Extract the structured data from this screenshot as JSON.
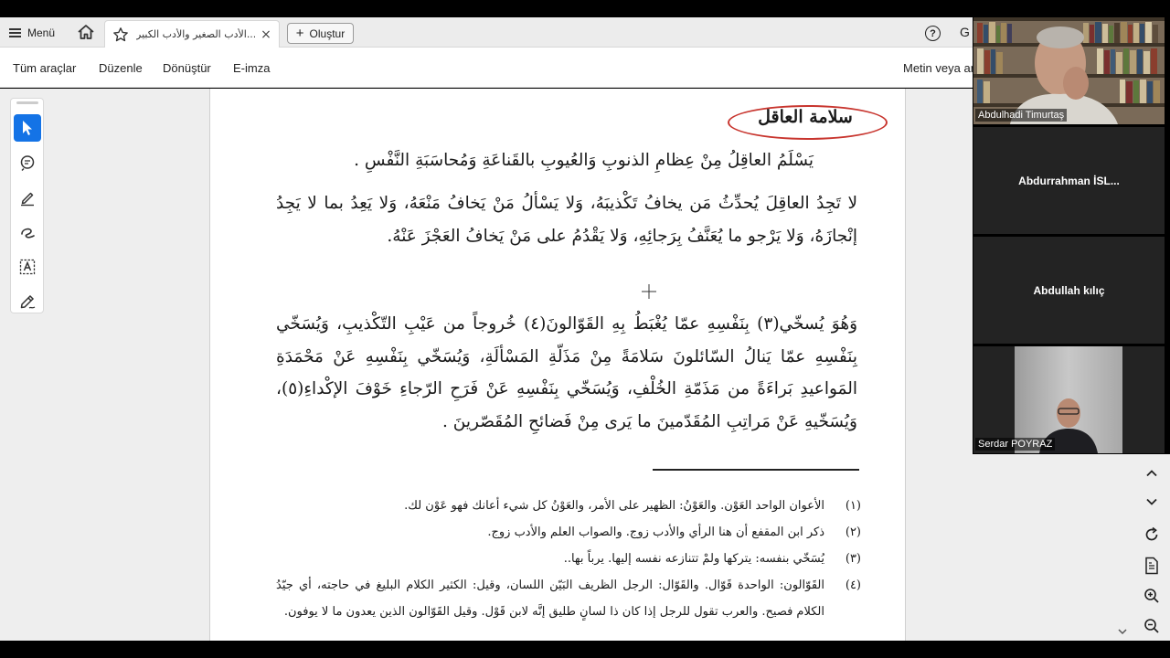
{
  "browser": {
    "menu_label": "Menü",
    "tab_title": "الأدب الصغير والأدب الكبير...",
    "close_symbol": "×",
    "create_label": "Oluştur",
    "help_symbol": "?",
    "profile_letter": "G"
  },
  "toolbar": {
    "all_tools": "Tüm araçlar",
    "edit": "Düzenle",
    "convert": "Dönüştür",
    "esign": "E-imza",
    "search_text": "Metin veya ar"
  },
  "document": {
    "heading": "سلامة العاقل",
    "paragraph1": "يَسْلَمُ العاقِلُ مِنْ عِظامِ الذنوبِ وَالعُيوبِ بالقَناعَةِ وَمُحاسَبَةِ النَّفْسِ .",
    "paragraph2": "لا تَجِدُ العاقِلَ يُحدِّثُ مَن يخافُ تَكْذيبَهُ، وَلا يَسْألُ مَنْ يَخافُ مَنْعَهُ، وَلا يَعِدُ بما لا يَجِدُ إنْجازَهُ، وَلا يَرْجو ما يُعَنَّفُ بِرَجائِهِ، وَلا يَقْدُمُ على مَنْ يَخافُ العَجْزَ عَنْهُ.",
    "paragraph3": "وَهُوَ يُسخّي(٣) بِنَفْسِهِ عمّا يُغْبَطُ بِهِ القَوّالونَ(٤) خُروجاً من عَيْبِ التّكْذيبِ، وَيُسَخّي بِنَفْسِهِ عمّا يَنالُ السّائلونَ سَلامَةً مِنْ مَذَلّةِ المَسْألَةِ، وَيُسَخّي بِنَفْسِهِ عَنْ مَحْمَدَةِ المَواعيدِ بَراءَةً من مَذَمّةِ الخُلْفِ، وَيُسَخّي بِنَفْسِهِ عَنْ فَرَحِ الرّجاءِ خَوْفَ الإكْداءِ(٥)، وَيُسَخّيهِ عَنْ مَراتِبِ المُقَدّمينَ ما يَرى مِنْ فَضائحِ المُقَصّرينَ .",
    "footnotes": [
      {
        "num": "(١)",
        "text": "الأعوان الواحد العَوْن. والعَوْنُ: الظهير على الأمر، والعَوْنُ كل شيء أعانك فهو عَوْن لك."
      },
      {
        "num": "(٢)",
        "text": "ذكر ابن المقفع أن هنا الرأي والأدب زوج. والصواب العلم والأدب زوج."
      },
      {
        "num": "(٣)",
        "text": "يُسَخّي بنفسه: يتركها ولمْ تتنازعه نفسه إليها. يرباً بها.."
      },
      {
        "num": "(٤)",
        "text": "القَوّالون: الواحدة قَوّال. والقَوّال: الرجل الظريف البَيّن اللسان، وقيل: الكثير الكلام البليغ في حاجته، أي جيّدُ الكلام فصيح. والعرب تقول للرجل إذا كان ذا لسانٍ طليق إنَّه لابن قَوْل. وقيل القَوّالون الذين يعدون ما لا يوفون."
      }
    ]
  },
  "participants": [
    {
      "name": "Abdulhadi Timurtaş"
    },
    {
      "name": "Abdurrahman  İSL..."
    },
    {
      "name": "Abdullah kılıç"
    },
    {
      "name": "Serdar POYRAZ"
    }
  ],
  "colors": {
    "accent": "#1473e6",
    "oval": "#c8352e",
    "page": "#ffffff",
    "tile_bg": "#232323"
  }
}
